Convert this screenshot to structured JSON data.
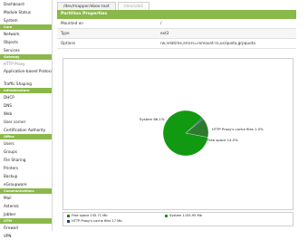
{
  "sidebar": {
    "items": [
      {
        "type": "item",
        "label": "Dashboard"
      },
      {
        "type": "item",
        "label": "Module Status"
      },
      {
        "type": "item",
        "label": "System"
      },
      {
        "type": "header",
        "label": "Core"
      },
      {
        "type": "item",
        "label": "Network"
      },
      {
        "type": "item",
        "label": "Objects"
      },
      {
        "type": "item",
        "label": "Services"
      },
      {
        "type": "header",
        "label": "Gateway"
      },
      {
        "type": "item",
        "label": "HTTP Proxy",
        "active": true
      },
      {
        "type": "item",
        "label": "Application-based Protocols",
        "two": true
      },
      {
        "type": "item",
        "label": "Traffic Shaping"
      },
      {
        "type": "header",
        "label": "Infrastructure"
      },
      {
        "type": "item",
        "label": "DHCP"
      },
      {
        "type": "item",
        "label": "DNS"
      },
      {
        "type": "item",
        "label": "Web"
      },
      {
        "type": "item",
        "label": "User corner"
      },
      {
        "type": "item",
        "label": "Certification Authority"
      },
      {
        "type": "header",
        "label": "Office"
      },
      {
        "type": "item",
        "label": "Users"
      },
      {
        "type": "item",
        "label": "Groups"
      },
      {
        "type": "item",
        "label": "File Sharing"
      },
      {
        "type": "item",
        "label": "Printers"
      },
      {
        "type": "item",
        "label": "Backup"
      },
      {
        "type": "item",
        "label": "eGroupware"
      },
      {
        "type": "header",
        "label": "Communications"
      },
      {
        "type": "item",
        "label": "Mail"
      },
      {
        "type": "item",
        "label": "Asterisk"
      },
      {
        "type": "item",
        "label": "Jabber"
      },
      {
        "type": "header",
        "label": "UTM"
      },
      {
        "type": "item",
        "label": "Firewall"
      },
      {
        "type": "item",
        "label": "VPN"
      }
    ]
  },
  "tabs": [
    {
      "label": "/dev/mapper/ebox-root",
      "active": true
    },
    {
      "label": "/dev/sda1",
      "active": false
    }
  ],
  "partition": {
    "title": "Partition Properties",
    "rows": [
      {
        "label": "Mounted on",
        "value": "/"
      },
      {
        "label": "Type",
        "value": "ext3"
      },
      {
        "label": "Options",
        "value": "rw,relatime,errors=remount-ro,usrquota,grpquota"
      }
    ]
  },
  "colors": {
    "accent": "#8ab84a",
    "system_slice": "#119911",
    "proxy_slice": "#1a3f8f",
    "free_slice": "#2e7a2e"
  },
  "chart_data": {
    "type": "pie",
    "slices": [
      {
        "label": "System",
        "text": "System 86.1%",
        "value": 86.1,
        "color": "#119911"
      },
      {
        "label": "HTTP Proxy's cache files",
        "text": "HTTP Proxy's cache files 1.0%",
        "value": 1.0,
        "color": "#1a3f8f"
      },
      {
        "label": "Free space",
        "text": "Free space 14.0%",
        "value": 14.0,
        "color": "#2e7a2e"
      }
    ],
    "legend": [
      {
        "text": "Free space 135.71 Mb",
        "color": "#2e7a2e"
      },
      {
        "text": "System 1155.95 Mb",
        "color": "#119911"
      },
      {
        "text": "HTTP Proxy's cache files 17 Mb",
        "color": "#1a3f8f"
      }
    ]
  }
}
